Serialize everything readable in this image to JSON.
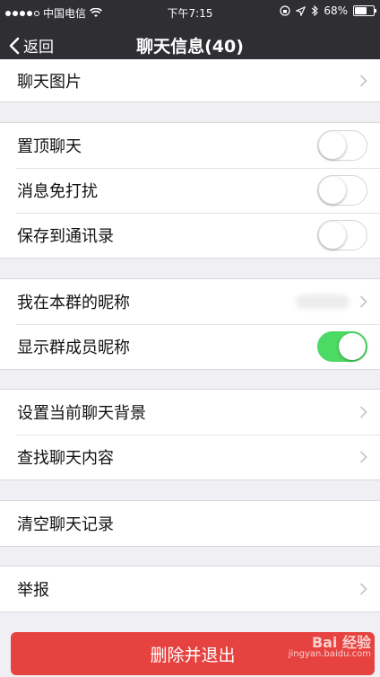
{
  "status_bar": {
    "carrier": "中国电信",
    "time": "下午7:15",
    "battery": "68%",
    "battery_level": 0.68
  },
  "nav": {
    "back_label": "返回",
    "title": "聊天信息(40)"
  },
  "groups": {
    "media": {
      "chat_images": "聊天图片"
    },
    "settings": {
      "pin_chat": {
        "label": "置顶聊天",
        "on": false
      },
      "mute": {
        "label": "消息免打扰",
        "on": false
      },
      "save_contacts": {
        "label": "保存到通讯录",
        "on": false
      }
    },
    "nickname": {
      "my_nickname": "我在本群的昵称",
      "show_member_nickname": {
        "label": "显示群成员昵称",
        "on": true
      }
    },
    "background": {
      "set_background": "设置当前聊天背景",
      "search_content": "查找聊天内容"
    },
    "clear": {
      "clear_history": "清空聊天记录"
    },
    "report": {
      "report": "举报"
    }
  },
  "delete_button": "删除并退出",
  "watermark": {
    "brand": "Bai 经验",
    "url": "jingyan.baidu.com"
  },
  "colors": {
    "toggle_on": "#4cd964",
    "danger": "#e64340",
    "navbar": "#2e2e33"
  }
}
